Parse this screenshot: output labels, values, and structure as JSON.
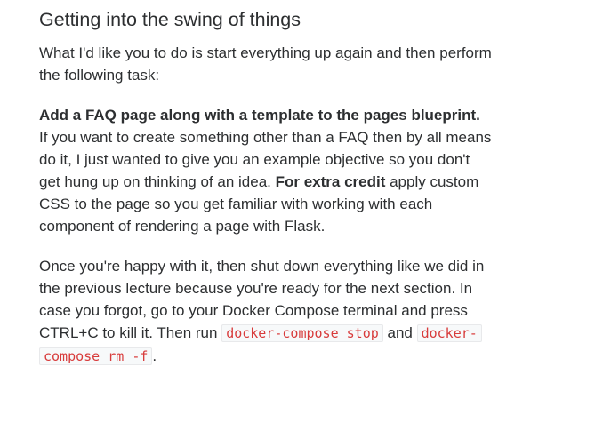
{
  "section": {
    "title": "Getting into the swing of things"
  },
  "intro": {
    "text": "What I'd like you to do is start everything up again and then perform the following task:"
  },
  "task": {
    "bold_lead": "Add a FAQ page along with a template to the pages blueprint.",
    "text_1": " If you want to create something other than a FAQ then by all means do it, I just wanted to give you an example objective so you don't get hung up on thinking of an idea. ",
    "bold_extra": "For extra credit",
    "text_2": " apply custom CSS to the page so you get familiar with working with each component of rendering a page with Flask."
  },
  "shutdown": {
    "text_1": "Once you're happy with it, then shut down everything like we did in the previous lecture because you're ready for the next section. In case you forgot, go to your Docker Compose terminal and press CTRL+C to kill it. Then run ",
    "code_1": "docker-compose stop",
    "text_2": " and ",
    "code_2": "docker-compose rm -f",
    "text_3": "."
  }
}
